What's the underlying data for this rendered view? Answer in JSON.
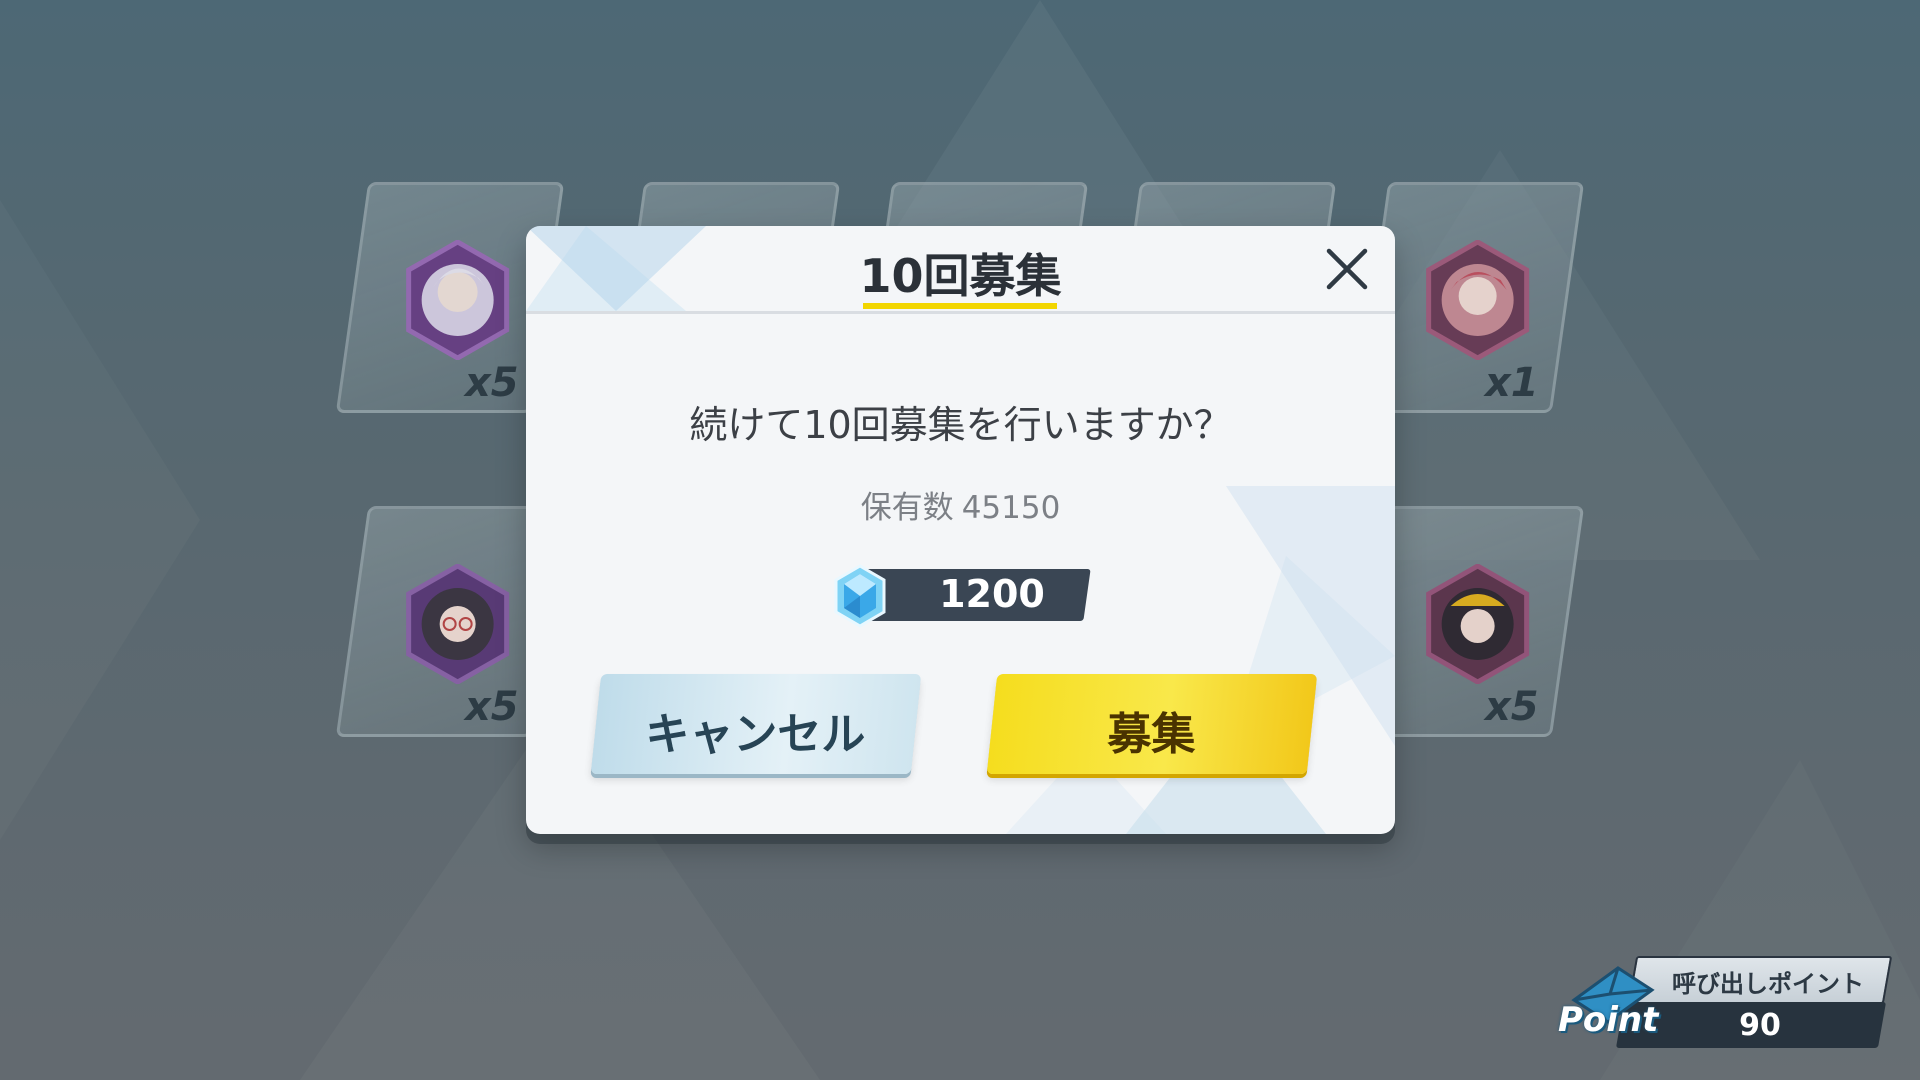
{
  "background": {
    "cards": [
      {
        "count": "x5",
        "portrait": "purple-hair-girl-portrait-icon",
        "frame_color": "#8a5aa3"
      },
      {
        "count": "",
        "portrait": "",
        "frame_color": ""
      },
      {
        "count": "",
        "portrait": "",
        "frame_color": ""
      },
      {
        "count": "",
        "portrait": "",
        "frame_color": ""
      },
      {
        "count": "x1",
        "portrait": "red-hair-girl-portrait-icon",
        "frame_color": "#9a4a6a"
      },
      {
        "count": "x5",
        "portrait": "black-hair-glasses-girl-portrait-icon",
        "frame_color": "#7a4f94"
      },
      {
        "count": "x5",
        "portrait": "black-hair-yellow-hat-girl-portrait-icon",
        "frame_color": "#8e4a78"
      }
    ]
  },
  "dialog": {
    "title": "10回募集",
    "question": "続けて10回募集を行いますか？",
    "owned_label": "保有数",
    "owned_value": "45150",
    "cost_value": "1200",
    "cost_icon": "crystal-gem-icon",
    "cancel_label": "キャンセル",
    "confirm_label": "募集",
    "close_icon": "close-icon"
  },
  "point_panel": {
    "label": "呼び出しポイント",
    "value": "90",
    "icon_text": "Point",
    "icon": "envelope-point-icon"
  },
  "colors": {
    "accent_yellow": "#f2d600",
    "cancel_button": "#cfe5ef",
    "confirm_button": "#f5dd1e",
    "dialog_bg": "#f4f6f8",
    "dark_bar": "#3a4654"
  }
}
